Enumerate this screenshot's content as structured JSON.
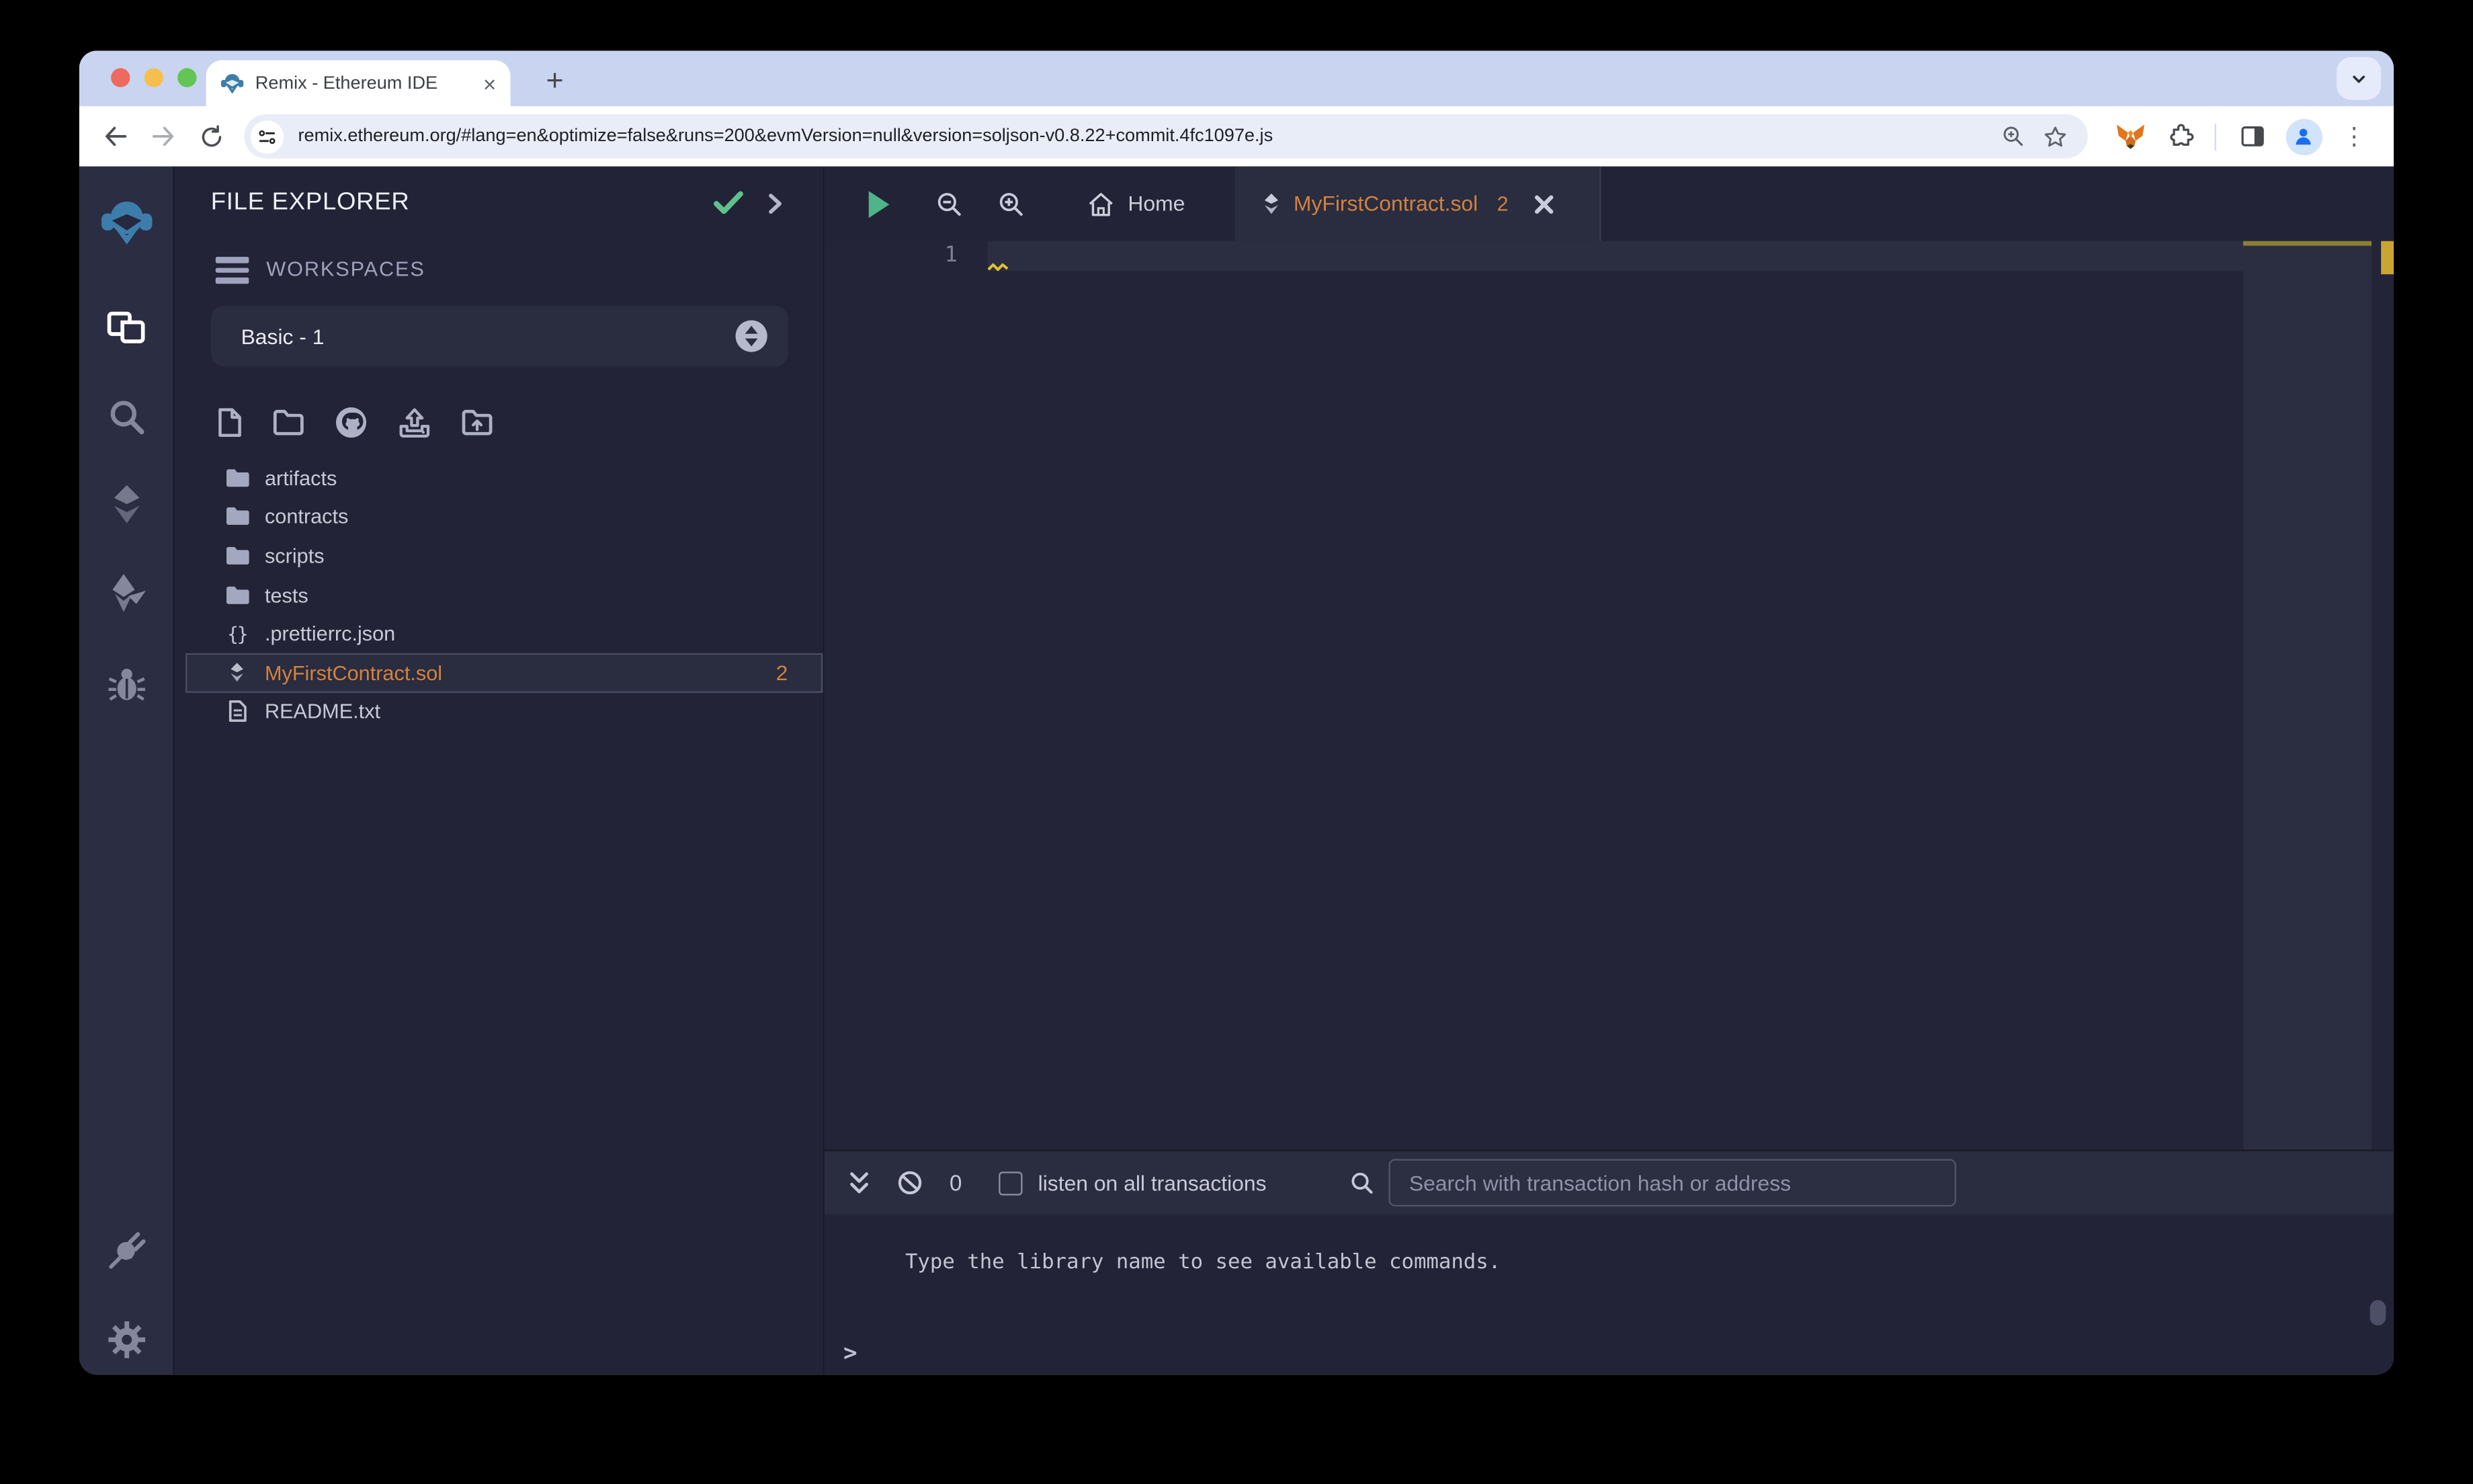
{
  "browser": {
    "tab_title": "Remix - Ethereum IDE",
    "url": "remix.ethereum.org/#lang=en&optimize=false&runs=200&evmVersion=null&version=soljson-v0.8.22+commit.4fc1097e.js",
    "icons": {
      "new_tab": "+",
      "tab_close": "×",
      "menu_dots": "⋮"
    }
  },
  "file_explorer": {
    "title": "FILE EXPLORER",
    "workspaces_label": "WORKSPACES",
    "workspace_selected": "Basic - 1",
    "files": [
      {
        "name": "artifacts",
        "type": "folder"
      },
      {
        "name": "contracts",
        "type": "folder"
      },
      {
        "name": "scripts",
        "type": "folder"
      },
      {
        "name": "tests",
        "type": "folder"
      },
      {
        "name": ".prettierrc.json",
        "type": "json",
        "icon_glyph": "{}"
      },
      {
        "name": "MyFirstContract.sol",
        "type": "solidity",
        "badge": "2",
        "selected": true
      },
      {
        "name": "README.txt",
        "type": "text"
      }
    ]
  },
  "editor": {
    "tabs": [
      {
        "label": "Home"
      },
      {
        "label": "MyFirstContract.sol",
        "badge": "2",
        "active": true
      }
    ],
    "line_number": "1",
    "warnings_on_line_1": true
  },
  "terminal": {
    "count": "0",
    "listen_label": "listen on all transactions",
    "search_placeholder": "Search with transaction hash or address",
    "message": "Type the library name to see available commands.",
    "prompt": ">"
  },
  "colors": {
    "accent_orange": "#d2823f",
    "check_green": "#5fc08c",
    "warning_yellow": "#c9a631",
    "remix_blue": "#3d7dab",
    "app_background": "#222336",
    "panel_light": "#2a2c3f"
  }
}
